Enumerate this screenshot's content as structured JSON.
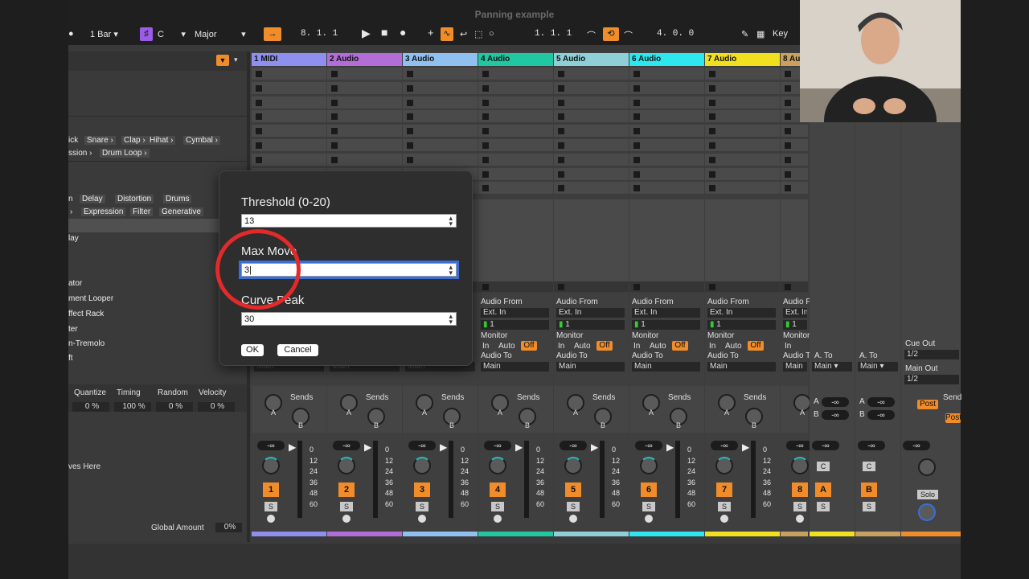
{
  "window": {
    "title": "Panning example"
  },
  "toolbar": {
    "quantize": "1 Bar",
    "key_root": "C",
    "scale": "Major",
    "position": "8.  1.  1",
    "loop_start": "1.  1.  1",
    "loop_length": "4.  0.  0",
    "key_label": "Key"
  },
  "browser": {
    "tags_row1": [
      "ick",
      "Snare",
      "Clap",
      "Hihat",
      "Cymbal"
    ],
    "tags_row2": [
      "ssion",
      "Drum Loop"
    ],
    "tags_row3": [
      "n",
      "Delay",
      "Distortion",
      "Drums"
    ],
    "tags_row4": [
      "Expression",
      "Filter",
      "Generative"
    ],
    "items": [
      "lay",
      "ator",
      "ment Looper",
      "ffect Rack",
      "ter",
      "n-Tremolo",
      "ft"
    ],
    "groove_headers": [
      "Quantize",
      "Timing",
      "Random",
      "Velocity"
    ],
    "groove_values": [
      "0 %",
      "100 %",
      "0 %",
      "0 %"
    ],
    "drop_hint": "ves Here",
    "global_amount_label": "Global Amount",
    "global_amount_value": "0%"
  },
  "tracks": [
    {
      "name": "1 MIDI",
      "color": "#8f8ff0",
      "num": "1"
    },
    {
      "name": "2 Audio",
      "color": "#b06ed6",
      "num": "2"
    },
    {
      "name": "3 Audio",
      "color": "#8fc0f0",
      "num": "3"
    },
    {
      "name": "4 Audio",
      "color": "#21c7a0",
      "num": "4"
    },
    {
      "name": "5 Audio",
      "color": "#8fd0d8",
      "num": "5"
    },
    {
      "name": "6 Audio",
      "color": "#2ee8f0",
      "num": "6"
    },
    {
      "name": "7 Audio",
      "color": "#f0e020",
      "num": "7"
    },
    {
      "name": "8 Au",
      "color": "#c8a060",
      "num": "8"
    }
  ],
  "io": {
    "audio_from": "Audio From",
    "ext_in": "Ext. In",
    "channel": "1",
    "monitor": "Monitor",
    "in": "In",
    "auto": "Auto",
    "off": "Off",
    "audio_to": "Audio To",
    "main": "Main",
    "sends": "Sends",
    "a": "A",
    "b": "B",
    "s": "S",
    "neg_inf": "-∞",
    "ticks": [
      "0",
      "12",
      "24",
      "36",
      "48",
      "60"
    ]
  },
  "returns": {
    "a_to": "A. To",
    "main": "Main",
    "a_label": "A",
    "b_label": "B",
    "c": "C",
    "cue_out": "Cue Out",
    "cue_val": "1/2",
    "main_out": "Main Out",
    "main_val": "1/2",
    "post": "Post",
    "sends": "Send",
    "solo": "Solo"
  },
  "dialog": {
    "threshold_label": "Threshold (0-20)",
    "threshold_value": "13",
    "maxmove_label": "Max Move",
    "maxmove_value": "3",
    "curvepeak_label": "Curve Peak",
    "curvepeak_value": "30",
    "ok": "OK",
    "cancel": "Cancel"
  }
}
